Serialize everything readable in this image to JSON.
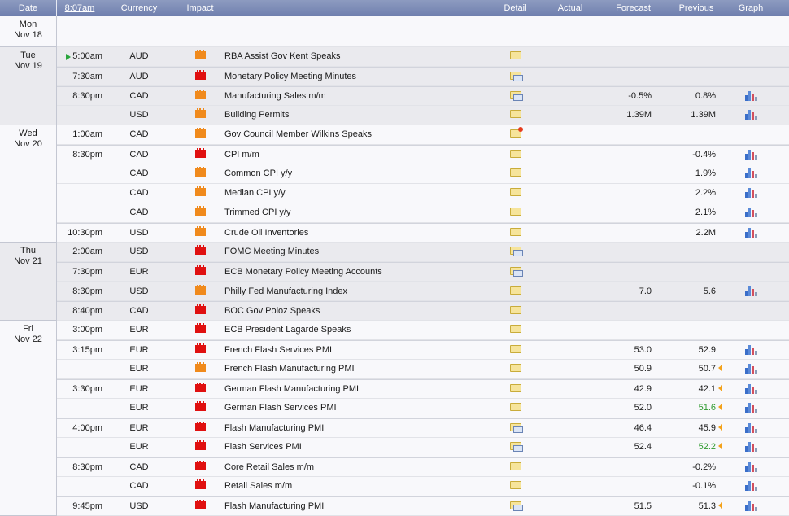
{
  "header": {
    "date": "Date",
    "time": "8:07am",
    "currency": "Currency",
    "impact": "Impact",
    "detail": "Detail",
    "actual": "Actual",
    "forecast": "Forecast",
    "previous": "Previous",
    "graph": "Graph"
  },
  "days": [
    {
      "weekday": "Mon",
      "date": "Nov 18",
      "events": []
    },
    {
      "weekday": "Tue",
      "date": "Nov 19",
      "events": [
        {
          "time": "5:00am",
          "now": true,
          "currency": "AUD",
          "impact": "medium",
          "event": "RBA Assist Gov Kent Speaks",
          "detail": "folder",
          "actual": "",
          "forecast": "",
          "previous": "",
          "graph": false
        },
        {
          "time": "7:30am",
          "currency": "AUD",
          "impact": "high",
          "event": "Monetary Policy Meeting Minutes",
          "detail": "open",
          "actual": "",
          "forecast": "",
          "previous": "",
          "graph": false
        },
        {
          "time": "8:30pm",
          "currency": "CAD",
          "impact": "medium",
          "event": "Manufacturing Sales m/m",
          "detail": "open",
          "actual": "",
          "forecast": "-0.5%",
          "previous": "0.8%",
          "graph": true
        },
        {
          "time": "",
          "currency": "USD",
          "impact": "medium",
          "event": "Building Permits",
          "detail": "folder",
          "actual": "",
          "forecast": "1.39M",
          "previous": "1.39M",
          "graph": true
        }
      ]
    },
    {
      "weekday": "Wed",
      "date": "Nov 20",
      "events": [
        {
          "time": "1:00am",
          "currency": "CAD",
          "impact": "medium",
          "event": "Gov Council Member Wilkins Speaks",
          "detail": "star",
          "actual": "",
          "forecast": "",
          "previous": "",
          "graph": false
        },
        {
          "time": "8:30pm",
          "currency": "CAD",
          "impact": "high",
          "event": "CPI m/m",
          "detail": "folder",
          "actual": "",
          "forecast": "",
          "previous": "-0.4%",
          "graph": true
        },
        {
          "time": "",
          "currency": "CAD",
          "impact": "medium",
          "event": "Common CPI y/y",
          "detail": "folder",
          "actual": "",
          "forecast": "",
          "previous": "1.9%",
          "graph": true
        },
        {
          "time": "",
          "currency": "CAD",
          "impact": "medium",
          "event": "Median CPI y/y",
          "detail": "folder",
          "actual": "",
          "forecast": "",
          "previous": "2.2%",
          "graph": true
        },
        {
          "time": "",
          "currency": "CAD",
          "impact": "medium",
          "event": "Trimmed CPI y/y",
          "detail": "folder",
          "actual": "",
          "forecast": "",
          "previous": "2.1%",
          "graph": true
        },
        {
          "time": "10:30pm",
          "currency": "USD",
          "impact": "medium",
          "event": "Crude Oil Inventories",
          "detail": "folder",
          "actual": "",
          "forecast": "",
          "previous": "2.2M",
          "graph": true
        }
      ]
    },
    {
      "weekday": "Thu",
      "date": "Nov 21",
      "events": [
        {
          "time": "2:00am",
          "currency": "USD",
          "impact": "high",
          "event": "FOMC Meeting Minutes",
          "detail": "open",
          "actual": "",
          "forecast": "",
          "previous": "",
          "graph": false
        },
        {
          "time": "7:30pm",
          "currency": "EUR",
          "impact": "high",
          "event": "ECB Monetary Policy Meeting Accounts",
          "detail": "open",
          "actual": "",
          "forecast": "",
          "previous": "",
          "graph": false
        },
        {
          "time": "8:30pm",
          "currency": "USD",
          "impact": "medium",
          "event": "Philly Fed Manufacturing Index",
          "detail": "folder",
          "actual": "",
          "forecast": "7.0",
          "previous": "5.6",
          "graph": true
        },
        {
          "time": "8:40pm",
          "currency": "CAD",
          "impact": "high",
          "event": "BOC Gov Poloz Speaks",
          "detail": "folder",
          "actual": "",
          "forecast": "",
          "previous": "",
          "graph": false
        }
      ]
    },
    {
      "weekday": "Fri",
      "date": "Nov 22",
      "events": [
        {
          "time": "3:00pm",
          "currency": "EUR",
          "impact": "high",
          "event": "ECB President Lagarde Speaks",
          "detail": "folder",
          "actual": "",
          "forecast": "",
          "previous": "",
          "graph": false
        },
        {
          "time": "3:15pm",
          "currency": "EUR",
          "impact": "high",
          "event": "French Flash Services PMI",
          "detail": "folder",
          "actual": "",
          "forecast": "53.0",
          "previous": "52.9",
          "graph": true
        },
        {
          "time": "",
          "currency": "EUR",
          "impact": "medium",
          "event": "French Flash Manufacturing PMI",
          "detail": "folder",
          "actual": "",
          "forecast": "50.9",
          "previous": "50.7",
          "revised": true,
          "graph": true
        },
        {
          "time": "3:30pm",
          "currency": "EUR",
          "impact": "high",
          "event": "German Flash Manufacturing PMI",
          "detail": "folder",
          "actual": "",
          "forecast": "42.9",
          "previous": "42.1",
          "revised": true,
          "graph": true
        },
        {
          "time": "",
          "currency": "EUR",
          "impact": "high",
          "event": "German Flash Services PMI",
          "detail": "folder",
          "actual": "",
          "forecast": "52.0",
          "previous": "51.6",
          "revised": true,
          "previous_color": "#2e9a2e",
          "graph": true
        },
        {
          "time": "4:00pm",
          "currency": "EUR",
          "impact": "high",
          "event": "Flash Manufacturing PMI",
          "detail": "open",
          "actual": "",
          "forecast": "46.4",
          "previous": "45.9",
          "revised": true,
          "graph": true
        },
        {
          "time": "",
          "currency": "EUR",
          "impact": "high",
          "event": "Flash Services PMI",
          "detail": "open",
          "actual": "",
          "forecast": "52.4",
          "previous": "52.2",
          "revised": true,
          "previous_color": "#2e9a2e",
          "graph": true
        },
        {
          "time": "8:30pm",
          "currency": "CAD",
          "impact": "high",
          "event": "Core Retail Sales m/m",
          "detail": "folder",
          "actual": "",
          "forecast": "",
          "previous": "-0.2%",
          "graph": true
        },
        {
          "time": "",
          "currency": "CAD",
          "impact": "high",
          "event": "Retail Sales m/m",
          "detail": "folder",
          "actual": "",
          "forecast": "",
          "previous": "-0.1%",
          "graph": true
        },
        {
          "time": "9:45pm",
          "currency": "USD",
          "impact": "high",
          "event": "Flash Manufacturing PMI",
          "detail": "open",
          "actual": "",
          "forecast": "51.5",
          "previous": "51.3",
          "revised": true,
          "graph": true
        }
      ]
    }
  ]
}
